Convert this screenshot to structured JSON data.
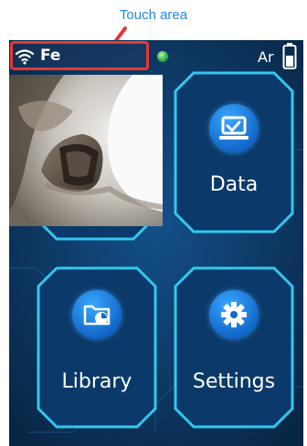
{
  "annotation": {
    "text": "Touch area"
  },
  "status": {
    "element": "Fe",
    "gas": "Ar"
  },
  "tiles": {
    "data": {
      "label": "Data",
      "icon": "laptop-check-icon"
    },
    "library": {
      "label": "Library",
      "icon": "folder-chart-icon"
    },
    "settings": {
      "label": "Settings",
      "icon": "gear-icon"
    }
  },
  "colors": {
    "annotation": "#1e88e5",
    "touch_box": "#e53935",
    "screen_bg": "#0b2f56",
    "tile_border": "#33c7ee"
  }
}
